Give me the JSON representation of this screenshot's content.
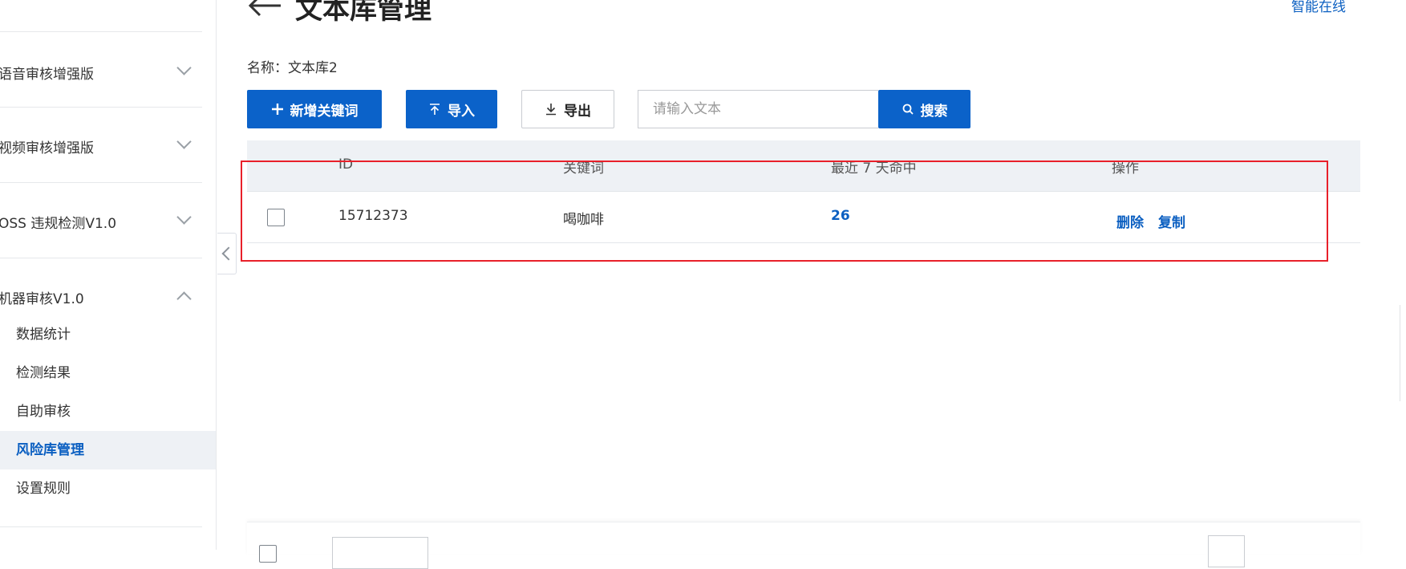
{
  "sidebar": {
    "groups": [
      {
        "label": "语音审核增强版"
      },
      {
        "label": "视频审核增强版"
      },
      {
        "label": "OSS 违规检测V1.0"
      },
      {
        "label": "机器审核V1.0"
      }
    ],
    "sub_items": [
      {
        "label": "数据统计"
      },
      {
        "label": "检测结果"
      },
      {
        "label": "自助审核"
      },
      {
        "label": "风险库管理",
        "active": true
      },
      {
        "label": "设置规则"
      }
    ]
  },
  "header": {
    "title": "文本库管理",
    "top_link": "智能在线"
  },
  "library": {
    "name_label": "名称：",
    "name_value": "文本库2"
  },
  "toolbar": {
    "add_label": "新增关键词",
    "import_label": "导入",
    "export_label": "导出",
    "search_placeholder": "请输入文本",
    "search_label": "搜索"
  },
  "table": {
    "columns": [
      "ID",
      "关键词",
      "最近 7 天命中",
      "操作"
    ],
    "rows": [
      {
        "id": "15712373",
        "keyword": "喝咖啡",
        "hits": "26",
        "actions": [
          "删除",
          "复制"
        ]
      }
    ]
  },
  "colors": {
    "primary": "#0b62c9",
    "link": "#0b5fc1",
    "highlight_box": "#e8202a"
  }
}
